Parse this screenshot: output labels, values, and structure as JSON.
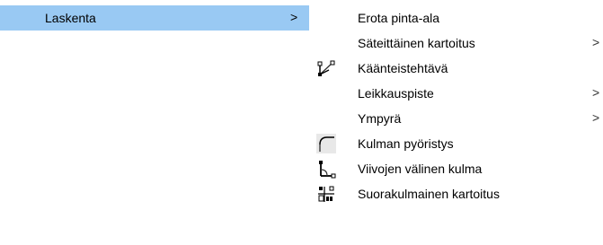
{
  "parent_menu": {
    "item": {
      "label": "Laskenta",
      "arrow": ">"
    }
  },
  "submenu": {
    "items": [
      {
        "label": "Erota pinta-ala",
        "has_submenu": false,
        "icon": null
      },
      {
        "label": "Säteittäinen kartoitus",
        "has_submenu": true,
        "arrow": ">",
        "icon": null
      },
      {
        "label": "Käänteistehtävä",
        "has_submenu": false,
        "icon": "inverse-problem-icon"
      },
      {
        "label": "Leikkauspiste",
        "has_submenu": true,
        "arrow": ">",
        "icon": null
      },
      {
        "label": "Ympyrä",
        "has_submenu": true,
        "arrow": ">",
        "icon": null
      },
      {
        "label": "Kulman pyöristys",
        "has_submenu": false,
        "icon": "corner-rounding-icon"
      },
      {
        "label": "Viivojen välinen kulma",
        "has_submenu": false,
        "icon": "angle-between-lines-icon"
      },
      {
        "label": "Suorakulmainen kartoitus",
        "has_submenu": false,
        "icon": "rectangular-survey-icon"
      }
    ]
  },
  "colors": {
    "highlight": "#99c9f3",
    "background": "#ffffff",
    "text": "#000000"
  }
}
